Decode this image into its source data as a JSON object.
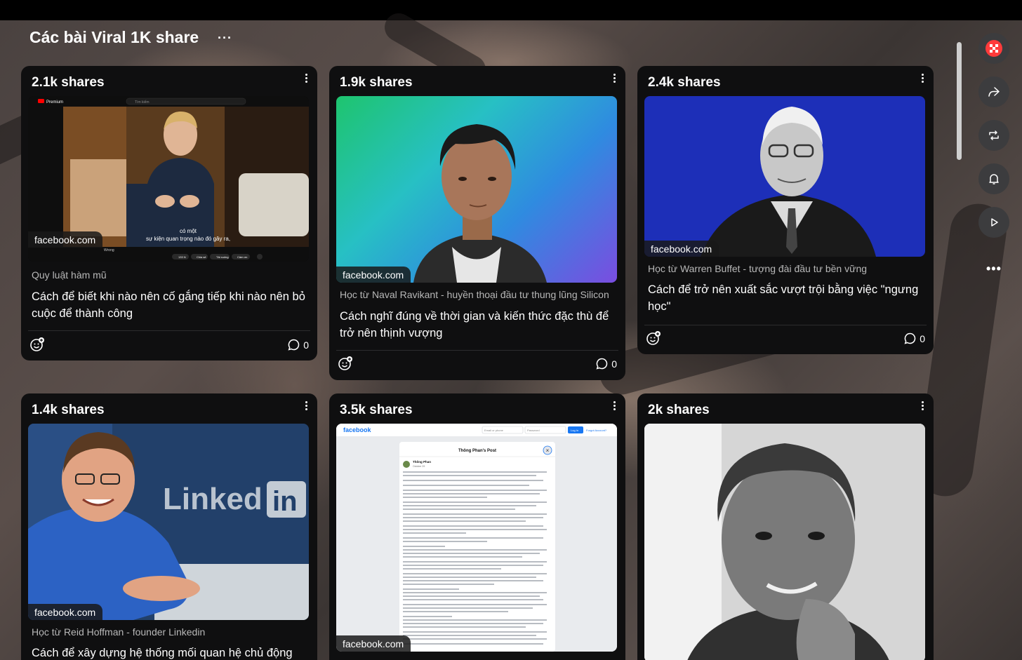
{
  "board": {
    "title": "Các bài Viral 1K share",
    "more_label": "···"
  },
  "cards": [
    {
      "shares": "2.1k shares",
      "domain": "facebook.com",
      "source": "Quy luật hàm mũ",
      "headline": "Cách để biết khi nào nên cố gắng tiếp khi nào nên bỏ cuộc để thành công",
      "comments": "0",
      "thumb": {
        "brand": "Premium",
        "search_placeholder": "Tìm kiếm",
        "subtitle_line1": "có một",
        "subtitle_line2": "sự kiện quan trọng nào đó gây ra,",
        "channel_tail": "Wrong",
        "actions": [
          "133 N",
          "Chia sẻ",
          "Tải xuống",
          "Cảm ơn"
        ]
      }
    },
    {
      "shares": "1.9k shares",
      "domain": "facebook.com",
      "source": "Học từ Naval Ravikant - huyền thoại đầu tư thung lũng Silicon",
      "headline": "Cách nghĩ đúng về thời gian và kiến thức đặc thù để trở nên thịnh vượng",
      "comments": "0"
    },
    {
      "shares": "2.4k shares",
      "domain": "facebook.com",
      "source": "Học từ Warren Buffet - tượng đài đầu tư bền vững",
      "headline": "Cách để trở nên xuất sắc vượt trội bằng việc \"ngưng học\"",
      "comments": "0"
    },
    {
      "shares": "1.4k shares",
      "domain": "facebook.com",
      "source": "Học từ Reid Hoffman - founder Linkedin",
      "headline": "Cách để xây dựng hệ thống mối quan hệ chủ động",
      "thumb": {
        "sign_text": "Linked",
        "sign_in": "in"
      }
    },
    {
      "shares": "3.5k shares",
      "domain": "facebook.com",
      "thumb": {
        "fb_logo": "facebook",
        "email_placeholder": "Email or phone",
        "password_placeholder": "Password",
        "login_label": "Log In",
        "forgot_label": "Forgot Account?",
        "post_title": "Thông Phan's Post",
        "author": "Thông Phan",
        "date": "October 29",
        "close_label": "×"
      }
    },
    {
      "shares": "2k shares"
    }
  ],
  "rail": {
    "buttons": [
      "avatar-icon",
      "share-icon",
      "repost-icon",
      "bell-icon",
      "play-icon"
    ],
    "more_label": "•••"
  },
  "colors": {
    "card_bg": "#0f0f10",
    "rail_btn": "#3c3c3e",
    "fb_blue": "#1877f2",
    "linkedin_bg": "#1b3552"
  }
}
